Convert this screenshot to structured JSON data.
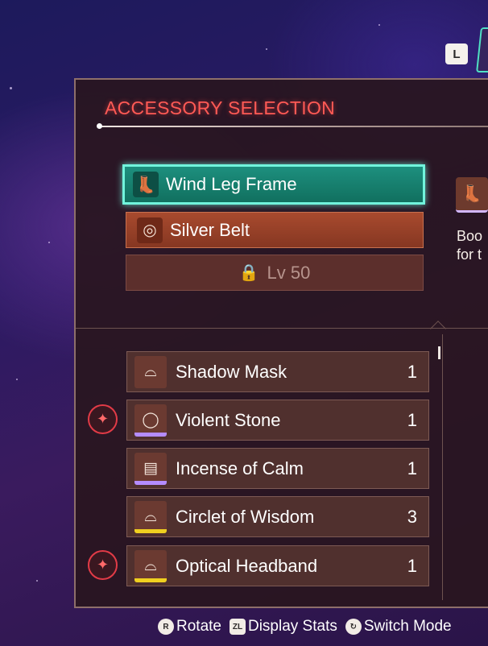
{
  "header": {
    "shoulder_button": "L",
    "panel_title": "ACCESSORY SELECTION"
  },
  "equipped": [
    {
      "label": "Wind Leg Frame",
      "icon": "boot-icon",
      "state": "selected"
    },
    {
      "label": "Silver Belt",
      "icon": "belt-icon",
      "state": "equipped"
    },
    {
      "label": "Lv 50",
      "icon": "lock-icon",
      "state": "locked"
    }
  ],
  "preview": {
    "icon": "boot-icon",
    "description_line1": "Boo",
    "description_line2": "for t"
  },
  "list": [
    {
      "label": "Shadow Mask",
      "count": "1",
      "icon": "mask-icon",
      "rarity_color": "",
      "party_marker": false
    },
    {
      "label": "Violent Stone",
      "count": "1",
      "icon": "ring-icon",
      "rarity_color": "#b58cff",
      "party_marker": true
    },
    {
      "label": "Incense of Calm",
      "count": "1",
      "icon": "incense-icon",
      "rarity_color": "#b58cff",
      "party_marker": false
    },
    {
      "label": "Circlet of Wisdom",
      "count": "3",
      "icon": "headband-icon",
      "rarity_color": "#f0d020",
      "party_marker": false
    },
    {
      "label": "Optical Headband",
      "count": "1",
      "icon": "headband-icon",
      "rarity_color": "#f0d020",
      "party_marker": true
    }
  ],
  "controls": [
    {
      "glyph": "R",
      "label": "Rotate"
    },
    {
      "glyph": "ZL",
      "label": "Display Stats"
    },
    {
      "glyph": "↻",
      "label": "Switch Mode"
    }
  ],
  "colors": {
    "accent_teal": "#71f4dc",
    "title_red": "#ff5a55",
    "panel_bg": "#29161f"
  }
}
